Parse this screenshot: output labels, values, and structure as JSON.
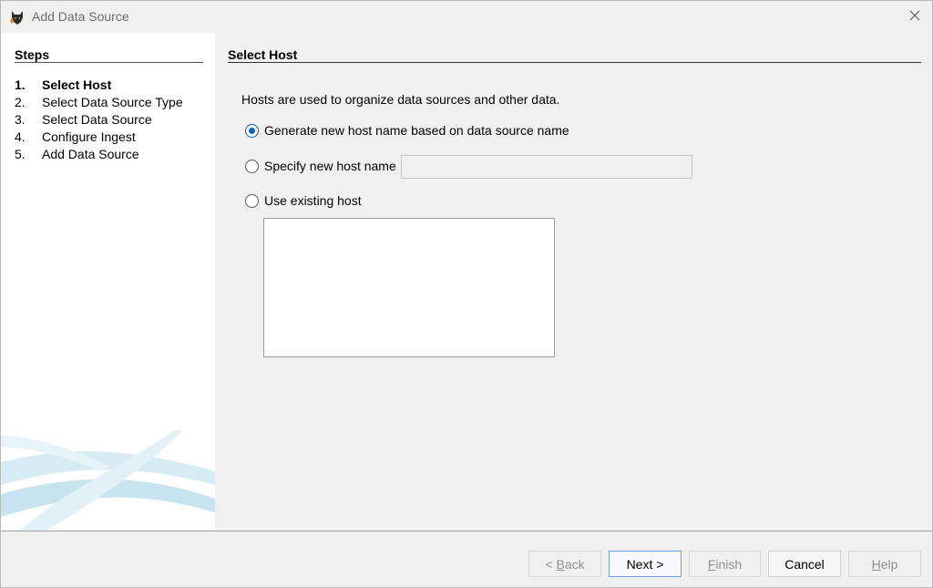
{
  "window": {
    "title": "Add Data Source",
    "app_icon": "autopsy-dog-icon",
    "close_icon": "close-icon"
  },
  "steps": {
    "title": "Steps",
    "items": [
      {
        "num": "1.",
        "label": "Select Host",
        "active": true
      },
      {
        "num": "2.",
        "label": "Select Data Source Type",
        "active": false
      },
      {
        "num": "3.",
        "label": "Select Data Source",
        "active": false
      },
      {
        "num": "4.",
        "label": "Configure Ingest",
        "active": false
      },
      {
        "num": "5.",
        "label": "Add Data Source",
        "active": false
      }
    ]
  },
  "content": {
    "title": "Select Host",
    "description": "Hosts are used to organize data sources and other data.",
    "options": [
      {
        "label": "Generate new host name based on data source name",
        "checked": true
      },
      {
        "label": "Specify new host name",
        "checked": false
      },
      {
        "label": "Use existing host",
        "checked": false
      }
    ],
    "new_host_name_value": ""
  },
  "footer": {
    "back_prefix": "< ",
    "back_mnemonic": "B",
    "back_rest": "ack",
    "next_label": "Next >",
    "finish_mnemonic": "F",
    "finish_rest": "inish",
    "cancel_label": "Cancel",
    "help_mnemonic": "H",
    "help_rest": "elp"
  },
  "colors": {
    "accent": "#0a5fbf",
    "decor": "#cfe6f0"
  }
}
